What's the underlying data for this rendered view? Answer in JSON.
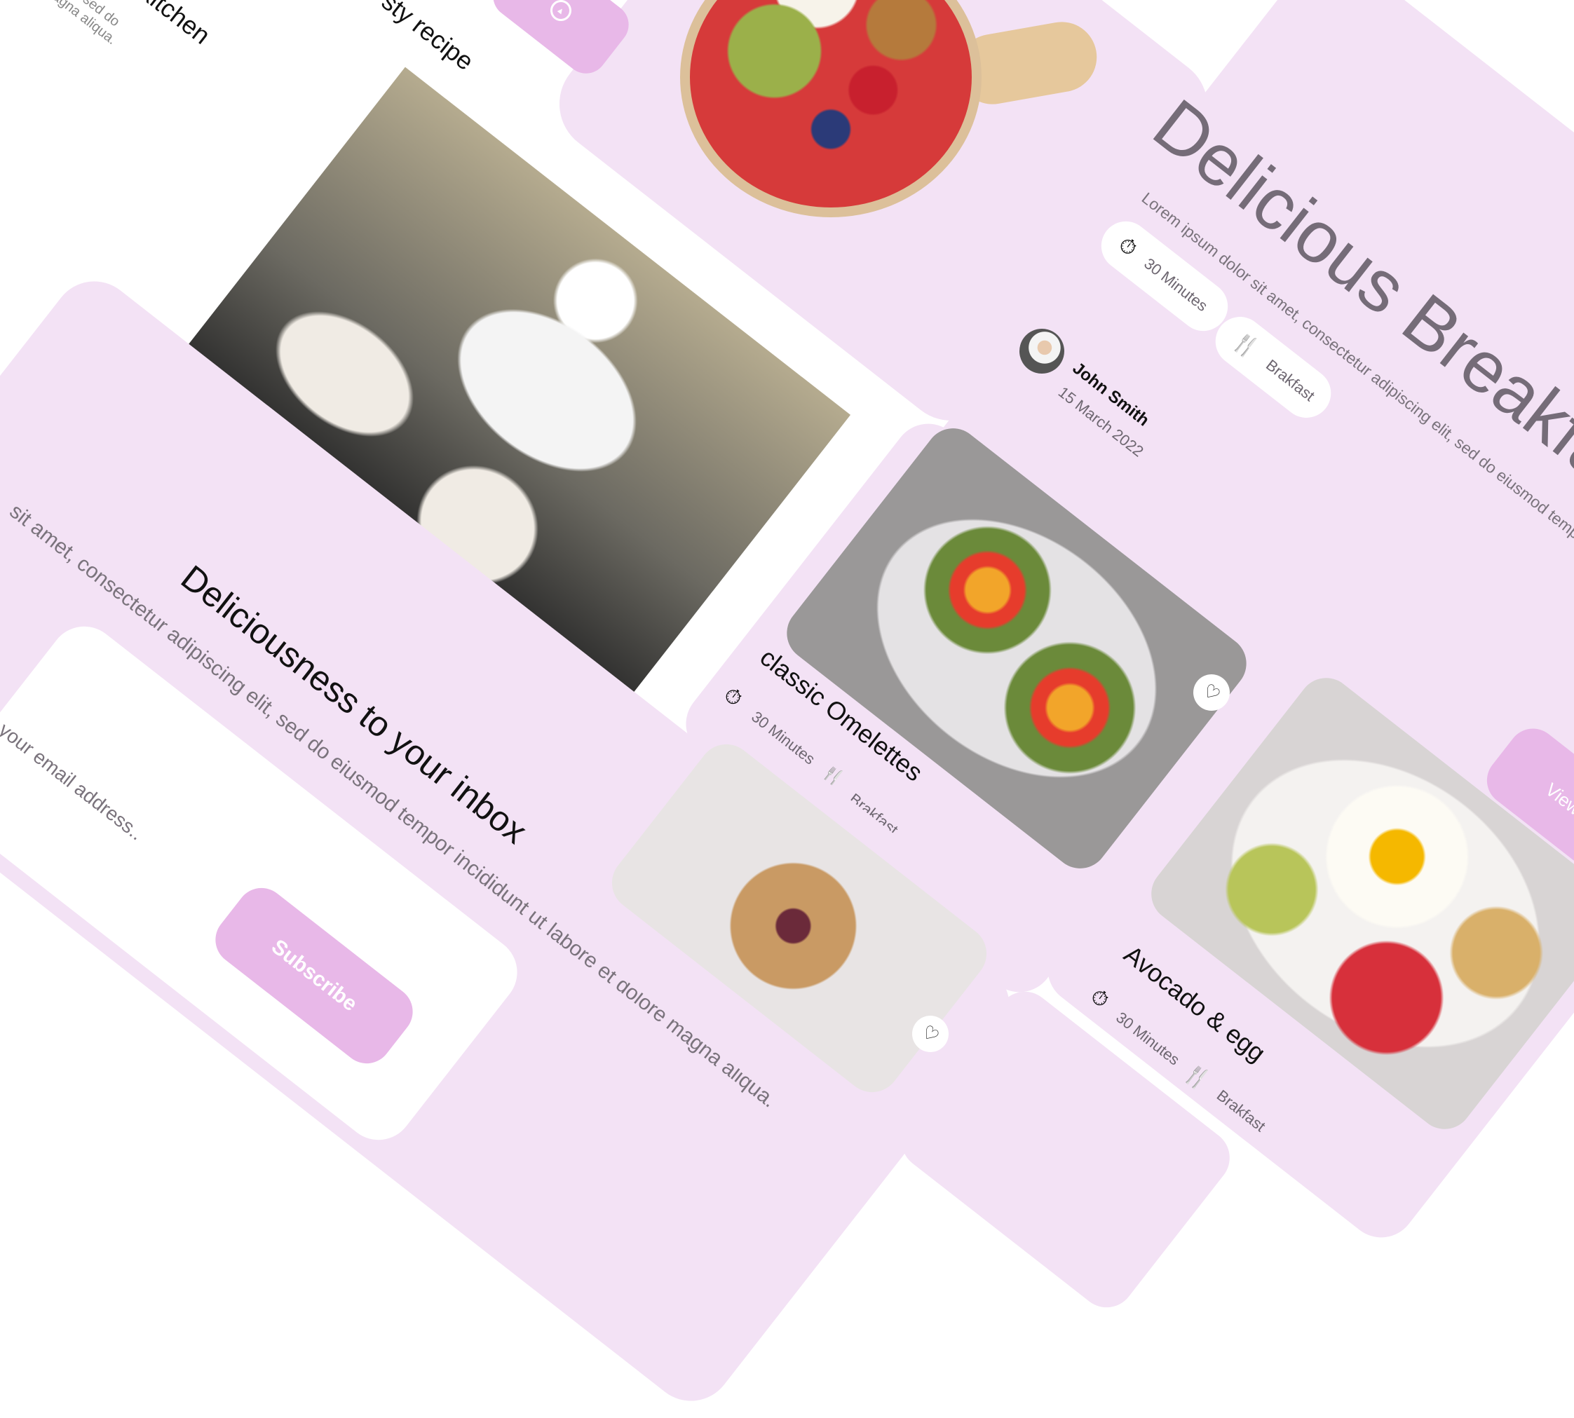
{
  "colors": {
    "card": "#f3e2f5",
    "accent": "#e8b8e8",
    "title": "#756c78"
  },
  "top_section": {
    "heading_left": "kitchen",
    "sub_left": "g elit, sed do\nmagna aliqua.",
    "heading_right": "sty recipe",
    "scroll_button_icon": "arrow-up-circle-icon"
  },
  "newsletter": {
    "title": "Deliciousness to your inbox",
    "description": "sit amet, consectetur adipiscing elit, sed do eiusmod tempor incididunt ut labore et dolore magna aliqua.",
    "email_placeholder": "your email address..",
    "subscribe_label": "Subscribe"
  },
  "hero": {
    "title": "Delicious Breakfast",
    "description": "Lorem ipsum dolor sit amet, consectetur adipiscing elit, sed do eiusmod tempor incididunt",
    "time": "30 Minutes",
    "category": "Brakfast",
    "author_name": "John Smith",
    "author_date": "15 March 2022",
    "view_label": "View"
  },
  "recipes": [
    {
      "title": "classic Omelettes",
      "time": "30 Minutes",
      "category": "Brakfast"
    },
    {
      "title": "Avocado & egg",
      "time": "30 Minutes",
      "category": "Brakfast"
    }
  ]
}
